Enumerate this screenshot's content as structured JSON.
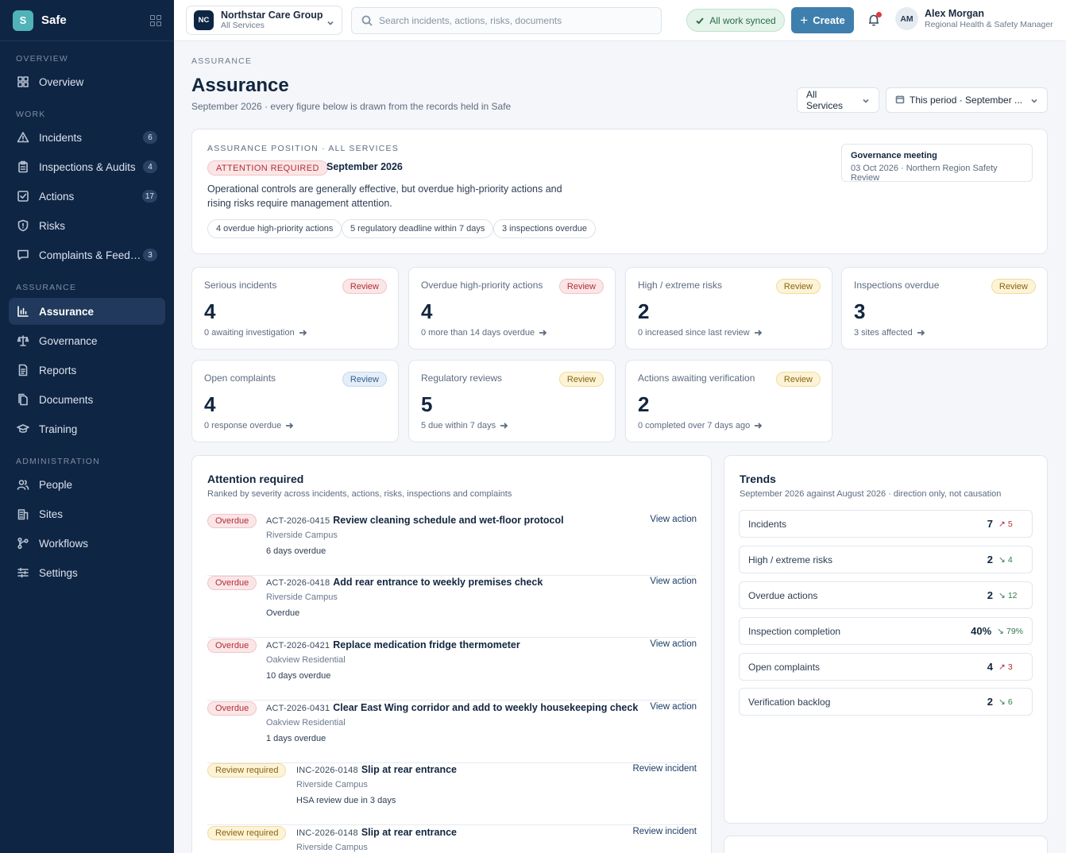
{
  "brand": {
    "logo_letter": "S",
    "name": "Safe"
  },
  "sidebar": {
    "sections": [
      {
        "label": "OVERVIEW"
      },
      {
        "label": "WORK"
      },
      {
        "label": "ASSURANCE"
      },
      {
        "label": "ADMINISTRATION"
      }
    ],
    "items": [
      {
        "label": "Overview",
        "icon": "grid-icon",
        "badge": ""
      },
      {
        "label": "Incidents",
        "icon": "warning-icon",
        "badge": "6"
      },
      {
        "label": "Inspections & Audits",
        "icon": "clipboard-icon",
        "badge": "4"
      },
      {
        "label": "Actions",
        "icon": "checkbox-icon",
        "badge": "17"
      },
      {
        "label": "Risks",
        "icon": "shield-icon",
        "badge": ""
      },
      {
        "label": "Complaints & Feed…",
        "icon": "message-icon",
        "badge": "3"
      },
      {
        "label": "Assurance",
        "icon": "bar-chart-icon",
        "badge": ""
      },
      {
        "label": "Governance",
        "icon": "scales-icon",
        "badge": ""
      },
      {
        "label": "Reports",
        "icon": "document-icon",
        "badge": ""
      },
      {
        "label": "Documents",
        "icon": "files-icon",
        "badge": ""
      },
      {
        "label": "Training",
        "icon": "graduation-cap-icon",
        "badge": ""
      },
      {
        "label": "People",
        "icon": "users-icon",
        "badge": ""
      },
      {
        "label": "Sites",
        "icon": "building-icon",
        "badge": ""
      },
      {
        "label": "Workflows",
        "icon": "workflow-icon",
        "badge": ""
      },
      {
        "label": "Settings",
        "icon": "sliders-icon",
        "badge": ""
      }
    ],
    "active": "Assurance"
  },
  "topbar": {
    "org_initials": "NC",
    "org_name": "Northstar Care Group",
    "org_scope": "All Services",
    "search_placeholder": "Search incidents, actions, risks, documents",
    "sync_status": "All work synced",
    "create_label": "Create",
    "user_initials": "AM",
    "user_name": "Alex Morgan",
    "user_role": "Regional Health & Safety Manager"
  },
  "header": {
    "eyebrow": "ASSURANCE",
    "title": "Assurance",
    "subtitle": "September 2026 · every figure below is drawn from the records held in Safe",
    "service_filter": "All Services",
    "period_filter": "This period · September ..."
  },
  "position": {
    "eyebrow": "ASSURANCE POSITION · ALL SERVICES",
    "status": "ATTENTION REQUIRED",
    "period": "September 2026",
    "description": "Operational controls are generally effective, but overdue high-priority actions and rising risks require management attention.",
    "chips": [
      "4 overdue high-priority actions",
      "5 regulatory deadline within 7 days",
      "3 inspections overdue"
    ],
    "meeting_title": "Governance meeting",
    "meeting_detail": "03 Oct 2026 · Northern Region Safety Review"
  },
  "kpis": [
    {
      "label": "Serious incidents",
      "pill": "Review",
      "tone": "red",
      "value": "4",
      "note": "0 awaiting investigation"
    },
    {
      "label": "Overdue high-priority actions",
      "pill": "Review",
      "tone": "red",
      "value": "4",
      "note": "0 more than 14 days overdue"
    },
    {
      "label": "High / extreme risks",
      "pill": "Review",
      "tone": "amber",
      "value": "2",
      "note": "0 increased since last review"
    },
    {
      "label": "Inspections overdue",
      "pill": "Review",
      "tone": "amber",
      "value": "3",
      "note": "3 sites affected"
    },
    {
      "label": "Open complaints",
      "pill": "Review",
      "tone": "blue",
      "value": "4",
      "note": "0 response overdue"
    },
    {
      "label": "Regulatory reviews",
      "pill": "Review",
      "tone": "amber",
      "value": "5",
      "note": "5 due within 7 days"
    },
    {
      "label": "Actions awaiting verification",
      "pill": "Review",
      "tone": "amber",
      "value": "2",
      "note": "0 completed over 7 days ago"
    }
  ],
  "attention": {
    "title": "Attention required",
    "subtitle": "Ranked by severity across incidents, actions, risks, inspections and complaints",
    "items": [
      {
        "pill": "Overdue",
        "tone": "red",
        "ref": "ACT-2026-0415",
        "title": "Review cleaning schedule and wet-floor protocol",
        "site": "Riverside Campus",
        "status": "6 days overdue",
        "link": "View action"
      },
      {
        "pill": "Overdue",
        "tone": "red",
        "ref": "ACT-2026-0418",
        "title": "Add rear entrance to weekly premises check",
        "site": "Riverside Campus",
        "status": "Overdue",
        "link": "View action"
      },
      {
        "pill": "Overdue",
        "tone": "red",
        "ref": "ACT-2026-0421",
        "title": "Replace medication fridge thermometer",
        "site": "Oakview Residential",
        "status": "10 days overdue",
        "link": "View action"
      },
      {
        "pill": "Overdue",
        "tone": "red",
        "ref": "ACT-2026-0431",
        "title": "Clear East Wing corridor and add to weekly housekeeping check",
        "site": "Oakview Residential",
        "status": "1 days overdue",
        "link": "View action"
      },
      {
        "pill": "Review required",
        "tone": "amber",
        "ref": "INC-2026-0148",
        "title": "Slip at rear entrance",
        "site": "Riverside Campus",
        "status": "HSA review due in 3 days",
        "link": "Review incident"
      },
      {
        "pill": "Review required",
        "tone": "amber",
        "ref": "INC-2026-0148",
        "title": "Slip at rear entrance",
        "site": "Riverside Campus",
        "status": "",
        "link": "Review incident"
      }
    ]
  },
  "trends": {
    "title": "Trends",
    "subtitle": "September 2026 against August 2026 · direction only, not causation",
    "rows": [
      {
        "label": "Incidents",
        "value": "7",
        "direction": "up",
        "previous": "5"
      },
      {
        "label": "High / extreme risks",
        "value": "2",
        "direction": "down",
        "previous": "4"
      },
      {
        "label": "Overdue actions",
        "value": "2",
        "direction": "down",
        "previous": "12"
      },
      {
        "label": "Inspection completion",
        "value": "40%",
        "direction": "down",
        "previous": "79%"
      },
      {
        "label": "Open complaints",
        "value": "4",
        "direction": "up",
        "previous": "3"
      },
      {
        "label": "Verification backlog",
        "value": "2",
        "direction": "down",
        "previous": "6"
      }
    ],
    "colors": {
      "up": "#b32d36",
      "down": "#2f7a4c"
    }
  }
}
